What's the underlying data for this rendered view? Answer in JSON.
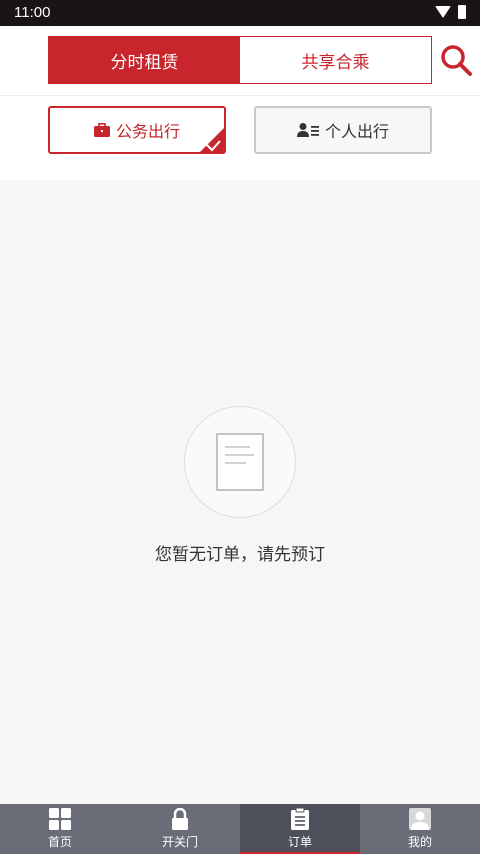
{
  "status_bar": {
    "time": "11:00"
  },
  "header": {
    "tabs": [
      {
        "label": "分时租赁",
        "active": true
      },
      {
        "label": "共享合乘",
        "active": false
      }
    ],
    "search_icon": "search-icon"
  },
  "travel_type": {
    "business": {
      "label": "公务出行",
      "icon": "briefcase-icon",
      "selected": true
    },
    "personal": {
      "label": "个人出行",
      "icon": "person-list-icon",
      "selected": false
    }
  },
  "empty_state": {
    "icon": "document-icon",
    "message": "您暂无订单，请先预订"
  },
  "tabbar": {
    "items": [
      {
        "label": "首页",
        "icon": "grid-icon"
      },
      {
        "label": "开关门",
        "icon": "lock-icon"
      },
      {
        "label": "订单",
        "icon": "clipboard-icon",
        "active": true
      },
      {
        "label": "我的",
        "icon": "user-icon"
      }
    ]
  },
  "colors": {
    "accent": "#c8252c",
    "tabbar": "#6a6d78",
    "status_bar": "#1b1414"
  }
}
